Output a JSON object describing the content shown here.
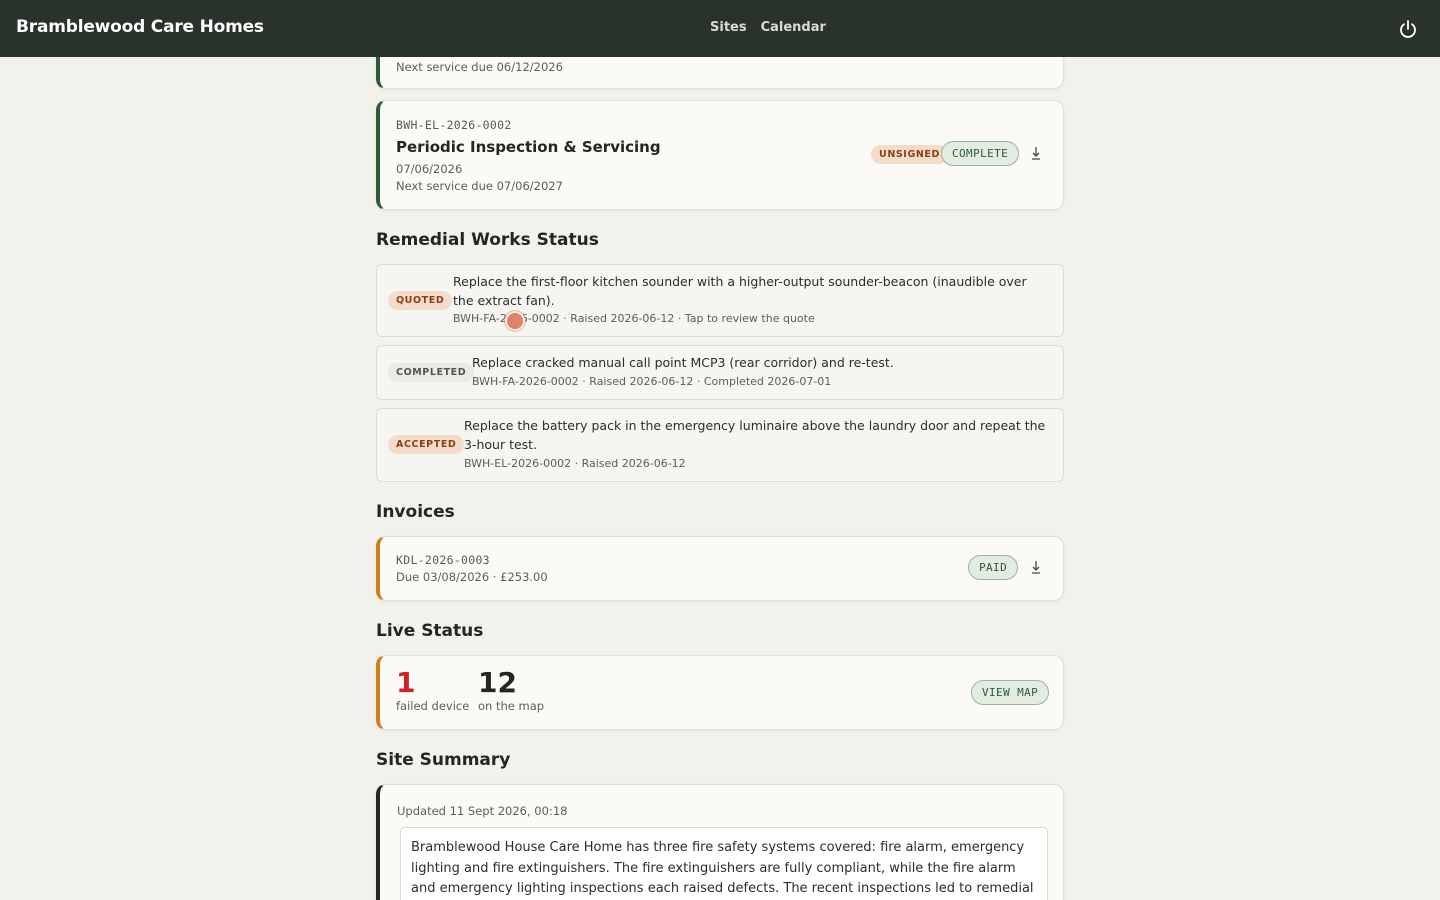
{
  "app": {
    "title": "Bramblewood Care Homes",
    "nav": [
      "Sites",
      "Calendar"
    ]
  },
  "certificates": [
    {
      "next_service": "Next service due 06/12/2026"
    },
    {
      "ref": "BWH-EL-2026-0002",
      "title": "Periodic Inspection & Servicing",
      "date": "07/06/2026",
      "next_service": "Next service due 07/06/2027",
      "badge_signed": "UNSIGNED",
      "status": "COMPLETE"
    }
  ],
  "remedial": {
    "heading": "Remedial Works Status",
    "items": [
      {
        "status": "QUOTED",
        "text": "Replace the first-floor kitchen sounder with a higher-output sounder-beacon (inaudible over the extract fan).",
        "meta": "BWH-FA-2026-0002 · Raised 2026-06-12 · Tap to review the quote"
      },
      {
        "status": "COMPLETED",
        "text": "Replace cracked manual call point MCP3 (rear corridor) and re-test.",
        "meta": "BWH-FA-2026-0002 · Raised 2026-06-12 · Completed 2026-07-01"
      },
      {
        "status": "ACCEPTED",
        "text": "Replace the battery pack in the emergency luminaire above the laundry door and repeat the 3-hour test.",
        "meta": "BWH-EL-2026-0002 · Raised 2026-06-12"
      }
    ]
  },
  "invoices": {
    "heading": "Invoices",
    "items": [
      {
        "ref": "KDL-2026-0003",
        "meta": "Due 03/08/2026 · £253.00",
        "status": "PAID"
      }
    ]
  },
  "live": {
    "heading": "Live Status",
    "failed_count": "1",
    "failed_label": "failed device",
    "map_count": "12",
    "map_label": "on the map",
    "button": "VIEW MAP"
  },
  "summary": {
    "heading": "Site Summary",
    "updated": "Updated 11 Sept 2026, 00:18",
    "body": "Bramblewood House Care Home has three fire safety systems covered: fire alarm, emergency lighting and fire extinguishers. The fire extinguishers are fully compliant, while the fire alarm and emergency lighting inspections each raised defects. The recent inspections led to remedial work, of"
  },
  "colors": {
    "topbar": "#29332b",
    "accent_green": "#2f5a34",
    "accent_orange": "#d07c17",
    "failed_red": "#c8242b"
  }
}
